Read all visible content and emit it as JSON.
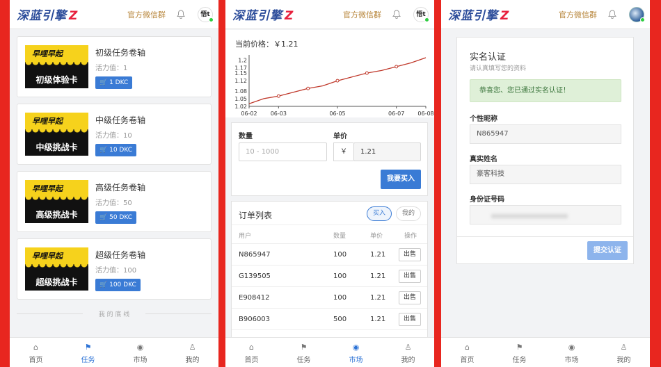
{
  "brand": {
    "name": "深蓝引擎",
    "z": "Z"
  },
  "header": {
    "wechat": "官方微信群"
  },
  "nav": [
    {
      "label": "首页",
      "icon": "home-icon"
    },
    {
      "label": "任务",
      "icon": "task-icon"
    },
    {
      "label": "市场",
      "icon": "market-icon"
    },
    {
      "label": "我的",
      "icon": "user-icon"
    }
  ],
  "tasks": {
    "items": [
      {
        "title": "初级任务卷轴",
        "vitality": "活力值：1",
        "button": "1 DKC",
        "logo": "早哩早起",
        "cap": "初级体验卡"
      },
      {
        "title": "中级任务卷轴",
        "vitality": "活力值：10",
        "button": "10 DKC",
        "logo": "早哩早起",
        "cap": "中级挑战卡"
      },
      {
        "title": "高级任务卷轴",
        "vitality": "活力值：50",
        "button": "50 DKC",
        "logo": "早哩早起",
        "cap": "高级挑战卡"
      },
      {
        "title": "超级任务卷轴",
        "vitality": "活力值：100",
        "button": "100 DKC",
        "logo": "早哩早起",
        "cap": "超级挑战卡"
      }
    ],
    "footer": "我 的 底 线"
  },
  "market": {
    "price_label": "当前价格：￥1.21",
    "form": {
      "qty_label": "数量",
      "qty_placeholder": "10 - 1000",
      "price_label": "单价",
      "currency": "￥",
      "price_value": "1.21",
      "buy_button": "我要买入"
    },
    "orders": {
      "title": "订单列表",
      "tab_buy": "买入",
      "tab_mine": "我的",
      "columns": [
        "用户",
        "数量",
        "单价",
        "操作"
      ],
      "rows": [
        {
          "user": "N865947",
          "qty": "100",
          "price": "1.21",
          "action": "出售"
        },
        {
          "user": "G139505",
          "qty": "100",
          "price": "1.21",
          "action": "出售"
        },
        {
          "user": "E908412",
          "qty": "100",
          "price": "1.21",
          "action": "出售"
        },
        {
          "user": "B906003",
          "qty": "500",
          "price": "1.21",
          "action": "出售"
        }
      ]
    }
  },
  "chart_data": {
    "type": "line",
    "x": [
      "06-02",
      "06-02.5",
      "06-03",
      "06-03.5",
      "06-04",
      "06-04.5",
      "06-05",
      "06-05.5",
      "06-06",
      "06-06.5",
      "06-07",
      "06-07.5",
      "06-08"
    ],
    "x_ticks": [
      "06-02",
      "06-03",
      "06-05",
      "06-07",
      "06-08"
    ],
    "y_ticks": [
      "1.2",
      "1.17",
      "1.15",
      "1.12",
      "1.08",
      "1.05",
      "1.02"
    ],
    "values": [
      1.03,
      1.05,
      1.06,
      1.075,
      1.09,
      1.1,
      1.12,
      1.135,
      1.15,
      1.16,
      1.175,
      1.19,
      1.21
    ],
    "ylim": [
      1.02,
      1.21
    ],
    "color": "#c0392b"
  },
  "profile": {
    "title": "实名认证",
    "subtitle": "请认真填写您的资料",
    "success": "恭喜您、您已通过实名认证！",
    "nickname_label": "个性昵称",
    "nickname": "N865947",
    "realname_label": "真实姓名",
    "realname": "豪客科技",
    "id_label": "身份证号码",
    "submit": "提交认证"
  }
}
